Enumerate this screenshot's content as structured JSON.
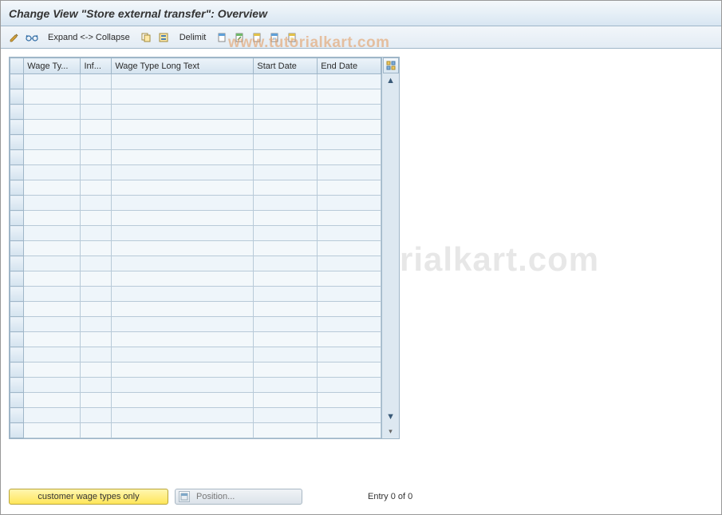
{
  "title": "Change View \"Store external transfer\": Overview",
  "toolbar": {
    "expand_collapse": "Expand <-> Collapse",
    "delimit": "Delimit"
  },
  "watermark1": "www.tutorialkart.com",
  "watermark2": "rialkart.com",
  "table": {
    "columns": [
      "Wage Ty...",
      "Inf...",
      "Wage Type Long Text",
      "Start Date",
      "End Date"
    ],
    "row_count": 24
  },
  "footer": {
    "customer_btn": "customer wage types only",
    "position_btn": "Position...",
    "entry_text": "Entry 0 of 0"
  }
}
